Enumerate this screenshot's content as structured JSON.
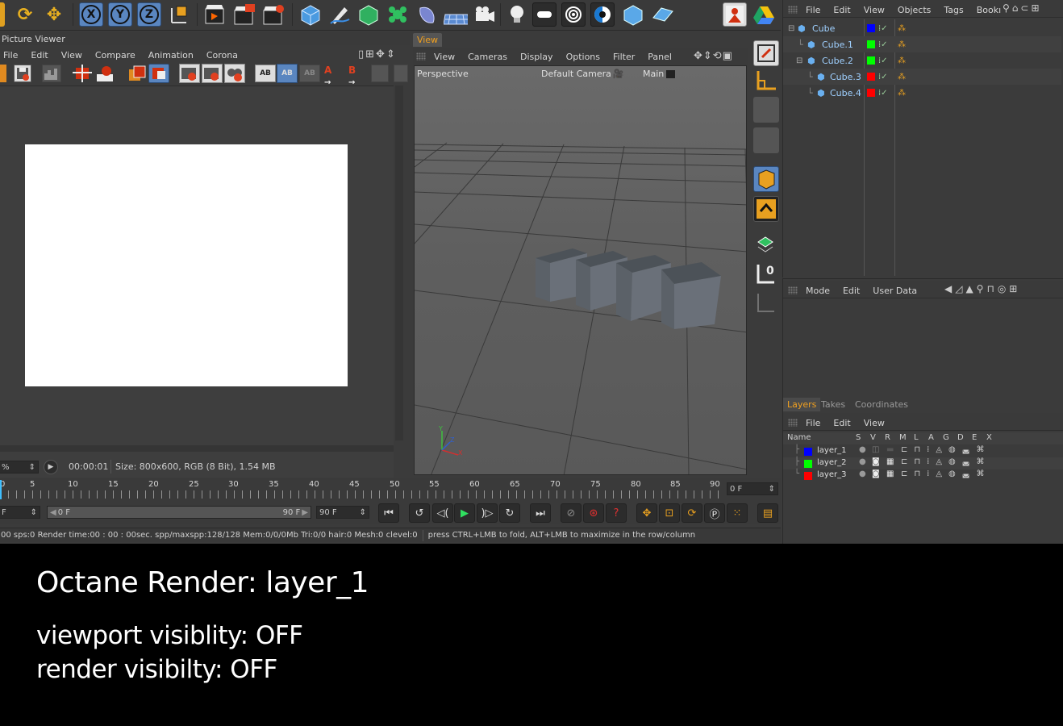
{
  "picture_viewer": {
    "title": "Picture Viewer",
    "menu": [
      "File",
      "Edit",
      "View",
      "Compare",
      "Animation",
      "Corona"
    ],
    "zoom": "%",
    "time": "00:00:01",
    "size_info": "Size: 800x600, RGB (8 Bit), 1.54 MB"
  },
  "viewport": {
    "tab": "View",
    "menu": [
      "View",
      "Cameras",
      "Display",
      "Options",
      "Filter",
      "Panel"
    ],
    "projection": "Perspective",
    "camera": "Default Camera",
    "take": "Main"
  },
  "object_manager": {
    "menu": [
      "File",
      "Edit",
      "View",
      "Objects",
      "Tags",
      "Bookı"
    ],
    "objects": [
      {
        "name": "Cube",
        "layer_color": "#0000ff"
      },
      {
        "name": "Cube.1",
        "layer_color": "#00ff00"
      },
      {
        "name": "Cube.2",
        "layer_color": "#00ff00"
      },
      {
        "name": "Cube.3",
        "layer_color": "#ff0000"
      },
      {
        "name": "Cube.4",
        "layer_color": "#ff0000"
      }
    ]
  },
  "attribute_manager": {
    "menu": [
      "Mode",
      "Edit",
      "User Data"
    ]
  },
  "layer_manager": {
    "tabs": [
      "Layers",
      "Takes",
      "Coordinates"
    ],
    "menu": [
      "File",
      "Edit",
      "View"
    ],
    "columns": [
      "Name",
      "S",
      "V",
      "R",
      "M",
      "L",
      "A",
      "G",
      "D",
      "E",
      "X"
    ],
    "layers": [
      {
        "name": "layer_1",
        "color": "#0000ff"
      },
      {
        "name": "layer_2",
        "color": "#00ff00"
      },
      {
        "name": "layer_3",
        "color": "#ff0000"
      }
    ]
  },
  "timeline": {
    "ticks": [
      "0",
      "5",
      "10",
      "15",
      "20",
      "25",
      "30",
      "35",
      "40",
      "45",
      "50",
      "55",
      "60",
      "65",
      "70",
      "75",
      "80",
      "85",
      "90"
    ],
    "current_frame": "0 F",
    "start_field": "F",
    "range_start": "0 F",
    "range_end": "90 F",
    "end_field": "90 F"
  },
  "status": {
    "render_info": "00 sps:0 Render time:00 : 00 : 00sec. spp/maxspp:128/128 Mem:0/0/0Mb Tri:0/0 hair:0 Mesh:0 clevel:0",
    "hint": "press CTRL+LMB to fold, ALT+LMB to maximize in the row/column"
  },
  "caption": {
    "title": "Octane Render:  layer_1",
    "line1": "viewport visiblity: OFF",
    "line2": "render visibilty: OFF"
  },
  "colors": {
    "accent_orange": "#f0a020",
    "axis_blue": "#5a86c0",
    "panel_bg": "#3b3b3b"
  }
}
